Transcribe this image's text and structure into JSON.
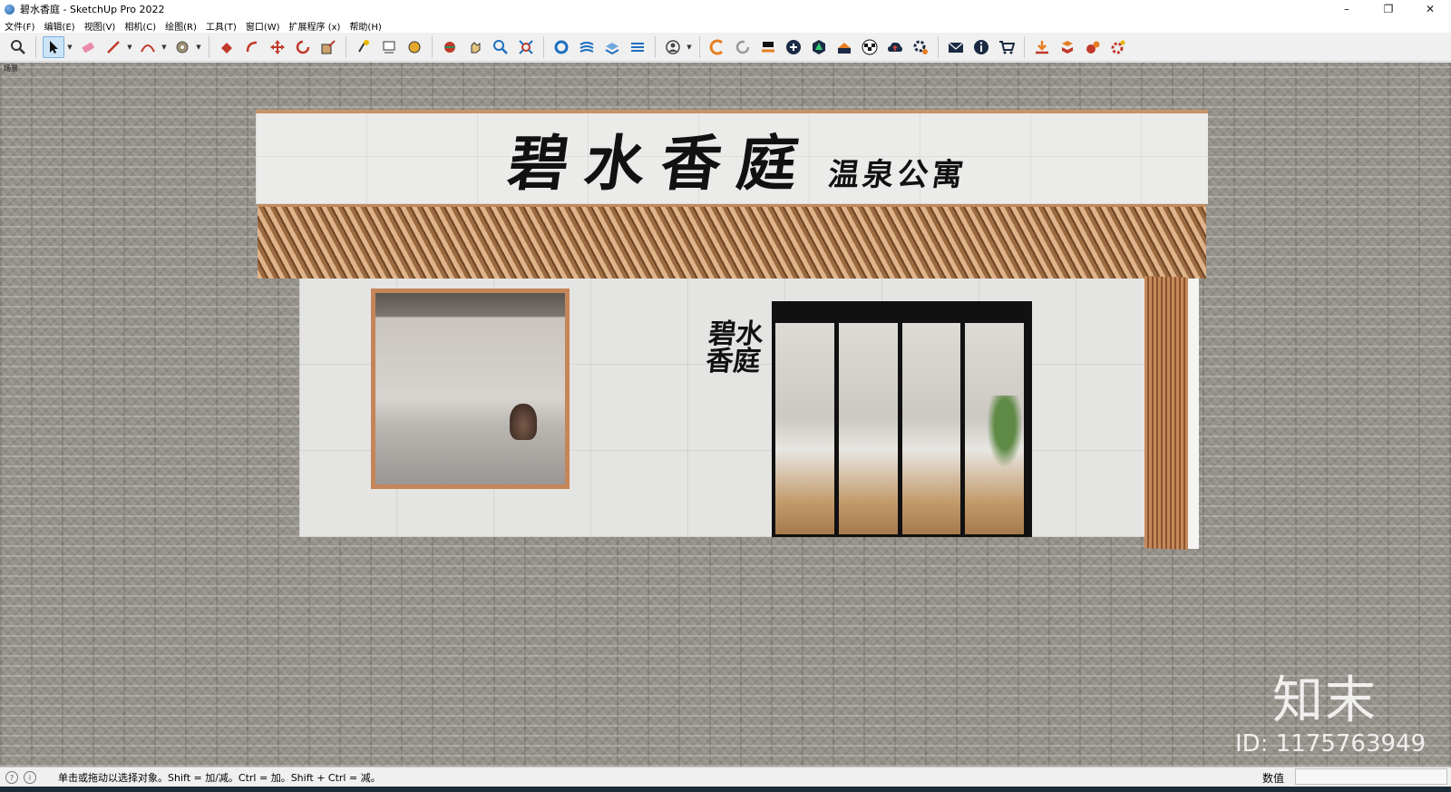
{
  "window": {
    "title": "碧水香庭 - SketchUp Pro 2022",
    "controls": [
      "–",
      "❐",
      "✕"
    ]
  },
  "menu": {
    "items": [
      "文件(F)",
      "编辑(E)",
      "视图(V)",
      "相机(C)",
      "绘图(R)",
      "工具(T)",
      "窗口(W)",
      "扩展程序 (x)",
      "帮助(H)"
    ]
  },
  "toolbar": {
    "icons": [
      "zoom-extents-icon",
      "select-icon",
      "eraser-icon",
      "pencil-icon",
      "arc-icon",
      "tape-icon",
      "paint-bucket-icon",
      "push-pull-icon",
      "move-icon",
      "rotate-icon",
      "scale-icon",
      "text-icon",
      "dimension-icon",
      "section-icon",
      "orbit-icon",
      "pan-icon",
      "zoom-icon",
      "zoom-window-icon",
      "styles-icon",
      "layers-icon",
      "shadows-icon",
      "fog-icon",
      "user-icon",
      "extension-icon",
      "refresh-icon",
      "export-icon",
      "add-icon",
      "warehouse-icon",
      "geo-icon",
      "chess-icon",
      "cloud-icon",
      "settings-icon",
      "mail-icon",
      "info-icon",
      "cart-icon",
      "download-icon",
      "plugin-icon",
      "plugin2-icon",
      "gear-icon"
    ],
    "active_tool": "select-icon",
    "accent_color": "#1e6fc0"
  },
  "viewport": {
    "scene_label": "场景",
    "sign_main": "碧水香庭",
    "sign_sub": "温泉公寓",
    "vertical_sign": "碧水香庭",
    "watermark_logo": "知末",
    "watermark_id": "ID: 1175763949"
  },
  "status": {
    "hint": "单击或拖动以选择对象。Shift = 加/减。Ctrl = 加。Shift + Ctrl = 减。",
    "measurements_label": "数值",
    "measurements_value": ""
  }
}
